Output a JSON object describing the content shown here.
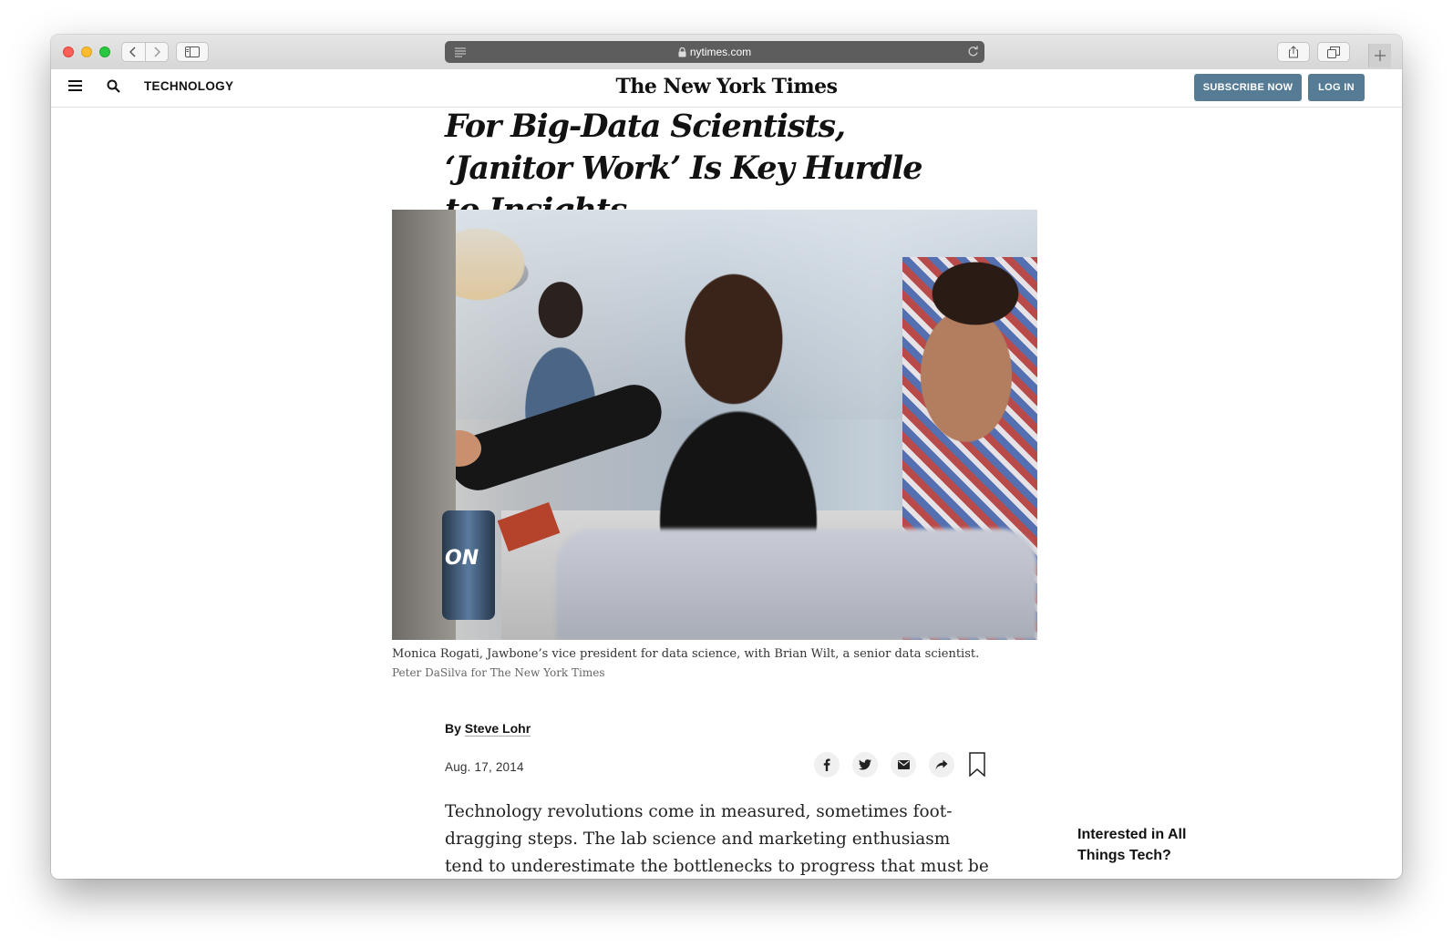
{
  "browser": {
    "url": "nytimes.com"
  },
  "header": {
    "section": "TECHNOLOGY",
    "masthead": "The New York Times",
    "subscribe_label": "SUBSCRIBE NOW",
    "login_label": "LOG IN",
    "button_color": "#567b95"
  },
  "article": {
    "headline": "For Big-Data Scientists, ‘Janitor Work’ Is Key Hurdle to Insights",
    "caption": "Monica Rogati, Jawbone’s vice president for data science, with Brian Wilt, a senior data scientist.",
    "credit": "Peter DaSilva for The New York Times",
    "by_prefix": "By",
    "author": "Steve Lohr",
    "date": "Aug. 17, 2014",
    "body": "Technology revolutions come in measured, sometimes foot-dragging steps. The lab science and marketing enthusiasm tend to underestimate the bottlenecks to progress that must be overcome",
    "photo_text": "ON"
  },
  "share": {
    "icons": [
      "facebook-icon",
      "twitter-icon",
      "email-icon",
      "share-icon",
      "bookmark-icon"
    ]
  },
  "aside": {
    "title": "Interested in All Things Tech?"
  }
}
